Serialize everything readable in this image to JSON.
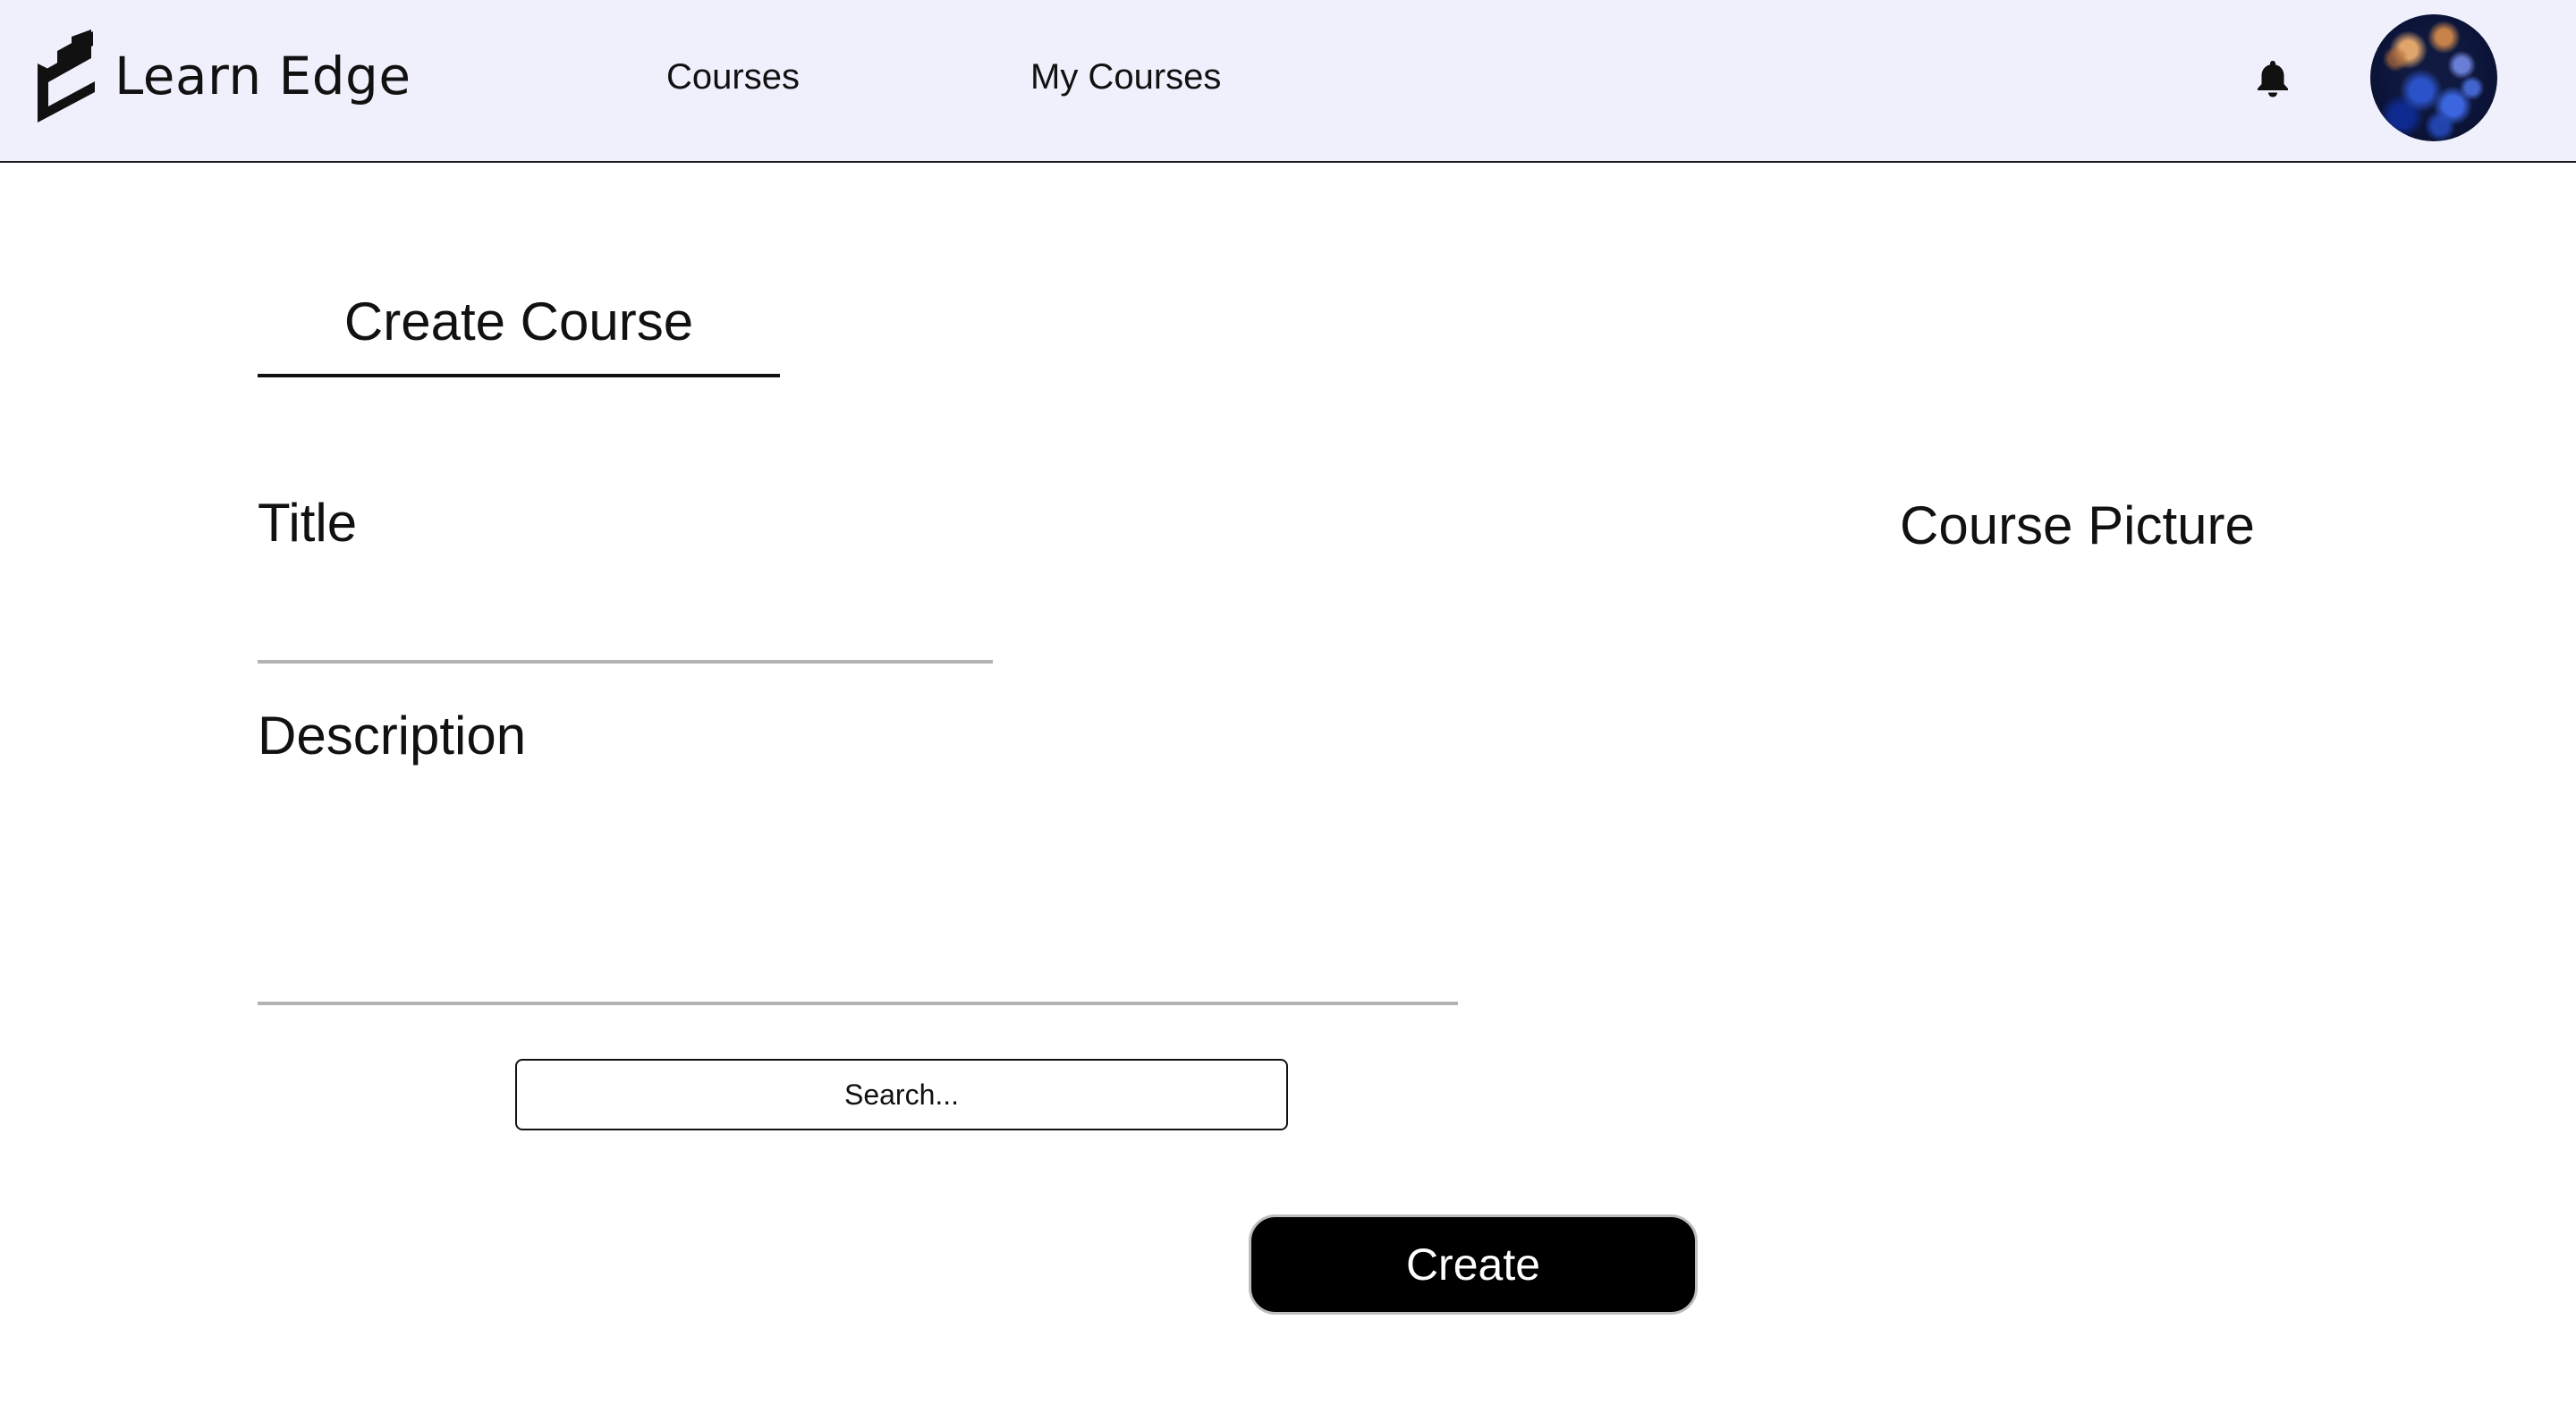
{
  "header": {
    "brand_name": "Learn Edge",
    "brand_icon": "learn-edge-logo",
    "nav": {
      "courses_label": "Courses",
      "my_courses_label": "My Courses"
    },
    "notification_icon": "bell-icon",
    "avatar_icon": "user-avatar"
  },
  "main": {
    "page_title": "Create Course",
    "title_label": "Title",
    "title_value": "",
    "description_label": "Description",
    "description_value": "",
    "course_picture_label": "Course Picture",
    "search_placeholder": "Search...",
    "create_button_label": "Create"
  },
  "colors": {
    "header_background": "#eff0fc",
    "button_background": "#000000",
    "button_text": "#ffffff",
    "input_underline": "#b3b3b3"
  }
}
